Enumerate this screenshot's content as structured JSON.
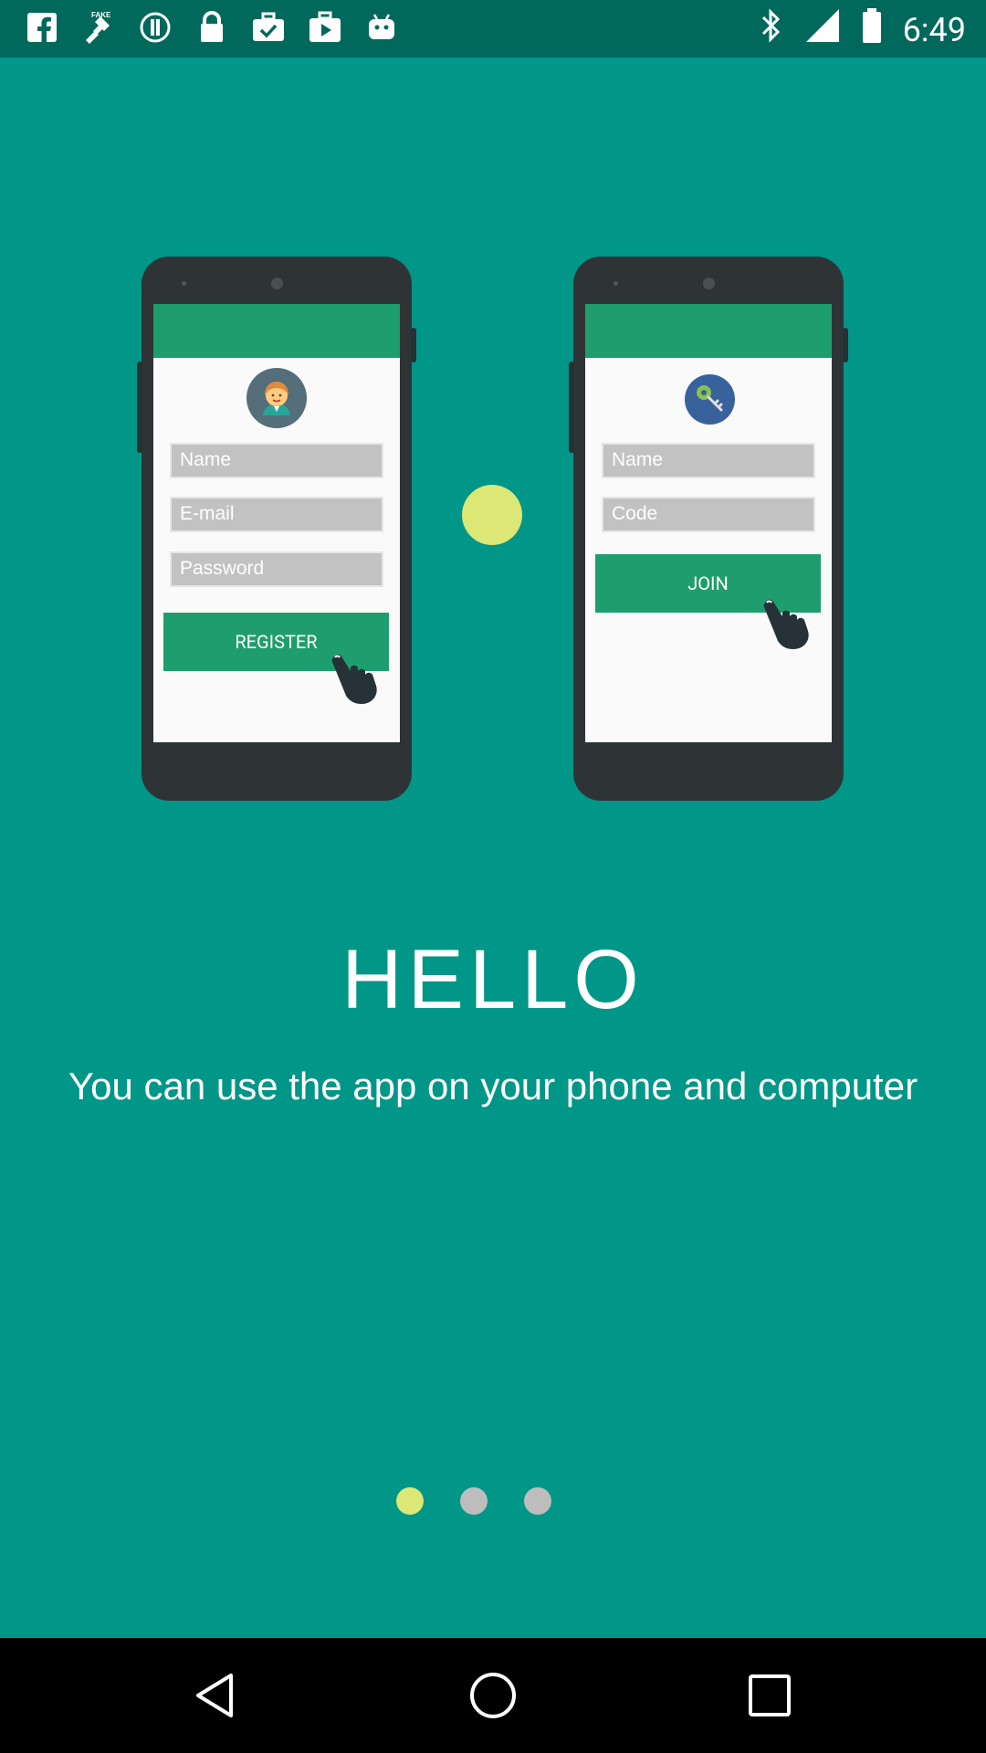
{
  "status_bar": {
    "time": "6:49",
    "left_icons": [
      "facebook-icon",
      "fake-gps-icon",
      "alert-icon",
      "lock-icon",
      "briefcase-check-icon",
      "play-store-icon",
      "android-icon"
    ],
    "right_icons": [
      "bluetooth-icon",
      "signal-icon",
      "battery-icon"
    ]
  },
  "phones": [
    {
      "avatar_icon": "person-avatar-icon",
      "fields": [
        "Name",
        "E-mail",
        "Password"
      ],
      "button": "REGISTER"
    },
    {
      "avatar_icon": "key-icon",
      "fields": [
        "Name",
        "Code"
      ],
      "button": "JOIN"
    }
  ],
  "heading": "HELLO",
  "subtitle": "You can use the app on your phone and computer",
  "pager": {
    "count": 3,
    "active_index": 0
  },
  "nav_bar": {
    "buttons": [
      "back-icon",
      "home-icon",
      "recents-icon"
    ]
  },
  "colors": {
    "background": "#009688",
    "status_bar": "#00695c",
    "accent_dot": "#dce775",
    "button_green": "#1e9e6e",
    "phone_body": "#2e3436"
  }
}
